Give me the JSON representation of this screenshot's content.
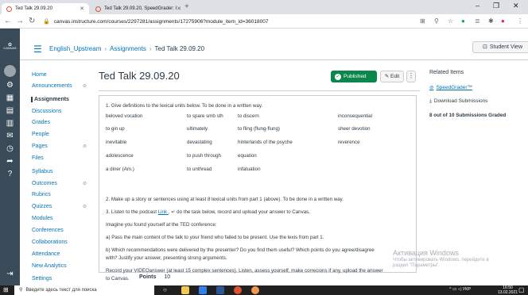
{
  "browser": {
    "tabs": [
      {
        "title": "Ted Talk 29.09.20"
      },
      {
        "title": "Ted Talk 29.09.20, SpeedGrader: I"
      }
    ],
    "url": "canvas.instructure.com/courses/2297281/assignments/17275906?module_item_id=36018007"
  },
  "global_nav": {
    "logo_text": "CANVAS"
  },
  "header": {
    "breadcrumbs": [
      "English_Upstream",
      "Assignments",
      "Ted Talk 29.09.20"
    ],
    "student_view_label": "Student View"
  },
  "course_nav": {
    "items": [
      {
        "label": "Home"
      },
      {
        "label": "Announcements",
        "hidden": true
      },
      {
        "label": "Assignments",
        "active": true
      },
      {
        "label": "Discussions"
      },
      {
        "label": "Grades"
      },
      {
        "label": "People"
      },
      {
        "label": "Pages",
        "hidden": true
      },
      {
        "label": "Files"
      },
      {
        "label": "Syllabus"
      },
      {
        "label": "Outcomes",
        "hidden": true
      },
      {
        "label": "Rubrics"
      },
      {
        "label": "Quizzes",
        "hidden": true
      },
      {
        "label": "Modules"
      },
      {
        "label": "Conferences"
      },
      {
        "label": "Collaborations"
      },
      {
        "label": "Attendance"
      },
      {
        "label": "New Analytics"
      },
      {
        "label": "Settings"
      }
    ]
  },
  "page": {
    "title": "Ted Talk 29.09.20",
    "published_label": "Published",
    "edit_label": "Edit",
    "more_label": "⋮",
    "points_label": "Points",
    "points_value": "10"
  },
  "content": {
    "task1": "1. Give definitions to the lexical units below.  To be done in a written way.",
    "vocab_rows": [
      [
        "beloved vocation",
        "to spare smb sth",
        "to discern",
        "inconsequential"
      ],
      [
        "to gin up",
        "ultimately",
        "to fling (flung-flung)",
        "sheer devotion"
      ],
      [
        "inevitable",
        "devastating",
        "hinterlands of the psyche",
        "reverence"
      ],
      [
        "adolescence",
        "to push through",
        "equation",
        ""
      ],
      [
        "a diner (Am.)",
        "to unthread",
        "infatuation",
        ""
      ]
    ],
    "task2": "2. Make up a story or sentences using  at least 8 lexical units from part 1 (above). To be done in a written way.",
    "task3_pre": "3. Listen to the podcast ",
    "task3_link": "Link ",
    "task3_post": ", ↵ do the task below, record and upload your answer to Canvas.",
    "imagine": "Imagine you found yourself at the TED conference:",
    "qa": "a) Pass the main content of the talk to your friend  who failed to be present. Use the lexis from part 1.",
    "qb1": "b) Which recommendations were delivered by the presenter? Do you find them useful? Which points do you agree/disagree",
    "qb2": "with? Justify your answer, presenting strong arguments.",
    "rec1": "Record your VIDEOanswer (at least 15 complex sentences). Listen, assess yourself, make correcions if any, upload the answer",
    "rec2": "to Canvas."
  },
  "sidebar": {
    "related_items": "Related Items",
    "speedgrader": "SpeedGrader™",
    "download": "Download Submissions",
    "graded": "8 out of 10 Submissions Graded"
  },
  "watermark": {
    "line1": "Активация Windows",
    "line2": "Чтобы активировать Windows, перейдите в",
    "line3": "раздел \"Параметры\"."
  },
  "taskbar": {
    "search_placeholder": "Введите здесь текст для поиска",
    "lang": "УКР",
    "time": "16:50",
    "date": "13.02.2021"
  },
  "colors": {
    "accent": "#0374b5",
    "published": "#0b874b",
    "global_nav": "#394b58"
  }
}
